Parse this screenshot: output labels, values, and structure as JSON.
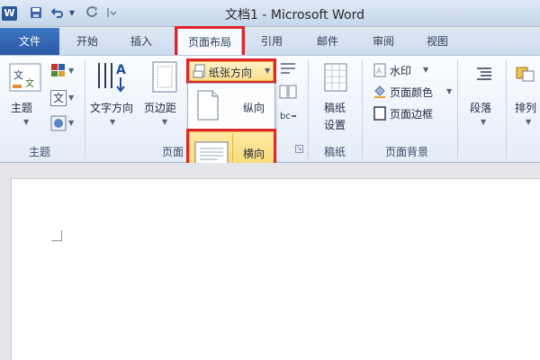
{
  "window": {
    "title": "文档1 - Microsoft Word"
  },
  "quick_access": {
    "logo": "W",
    "save": "save-icon",
    "undo": "undo-icon",
    "redo": "redo-icon"
  },
  "tabs": [
    {
      "label": "文件"
    },
    {
      "label": "开始"
    },
    {
      "label": "插入"
    },
    {
      "label": "页面布局"
    },
    {
      "label": "引用"
    },
    {
      "label": "邮件"
    },
    {
      "label": "审阅"
    },
    {
      "label": "视图"
    }
  ],
  "ribbon": {
    "themes_group": {
      "label": "主题",
      "themes_button": "主题"
    },
    "page_setup_group": {
      "label": "页面",
      "text_direction": "文字方向",
      "margins": "页边距",
      "orientation_button": "纸张方向",
      "orientation_options": {
        "portrait": "纵向",
        "landscape": "横向"
      }
    },
    "manuscript_group": {
      "label": "稿纸",
      "button_line1": "稿纸",
      "button_line2": "设置"
    },
    "page_background_group": {
      "label": "页面背景",
      "watermark": "水印",
      "page_color": "页面颜色",
      "page_borders": "页面边框"
    },
    "paragraph": {
      "label": "段落"
    },
    "arrange": {
      "label": "排列"
    }
  },
  "colors": {
    "accent_red": "#e0262c",
    "file_tab": "#2b5aa6",
    "highlight": "#f9d66b"
  }
}
